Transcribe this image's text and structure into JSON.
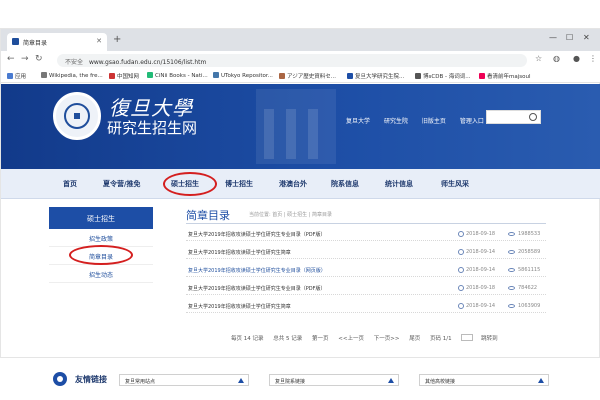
{
  "browser": {
    "tab_title": "简章目录",
    "url": "www.gsao.fudan.edu.cn/15106/list.htm",
    "security_label": "不安全"
  },
  "bookmarks": [
    {
      "label": "应用"
    },
    {
      "label": "Wikipedia, the fre..."
    },
    {
      "label": "中国知网"
    },
    {
      "label": "CiNii Books - Nati..."
    },
    {
      "label": "UTokyo Repositor..."
    },
    {
      "label": "アジア歴史資料セ..."
    },
    {
      "label": "复旦大学研究生院..."
    },
    {
      "label": "博sCDB - 海词词..."
    },
    {
      "label": "看清前年majsoul"
    }
  ],
  "header": {
    "logo_text": "復旦大學",
    "site_name": "研究生招生网",
    "top_links": [
      "复旦大学",
      "研究生院",
      "旧版主页",
      "管理入口"
    ]
  },
  "nav": {
    "items": [
      "首页",
      "夏令营/推免",
      "硕士招生",
      "博士招生",
      "港澳台外",
      "院系信息",
      "统计信息",
      "师生风采"
    ],
    "active": "硕士招生"
  },
  "sidebar": {
    "header": "硕士招生",
    "items": [
      "招生政策",
      "简章目录",
      "招生动态"
    ],
    "active": "简章目录"
  },
  "content": {
    "title": "简章目录",
    "breadcrumb": "当前位置: 首页 | 硕士招生 | 简章目录",
    "rows": [
      {
        "title": "复旦大学2019年招收攻读硕士学位研究生专业目录（PDF版）",
        "date": "2018-09-18",
        "views": "1988533"
      },
      {
        "title": "复旦大学2019年招收攻读硕士学位研究生简章",
        "date": "2018-09-14",
        "views": "2058589"
      },
      {
        "title": "复旦大学2019年招收攻读硕士学位研究生专业目录（网页版）",
        "date": "2018-09-14",
        "views": "5861115"
      },
      {
        "title": "复旦大学2019年招收攻读硕士学位研究生专业目录（PDF版）",
        "date": "2018-09-18",
        "views": "784622"
      },
      {
        "title": "复旦大学2019年招收攻读硕士学位研究生简章",
        "date": "2018-09-14",
        "views": "1063909"
      }
    ],
    "pager": {
      "total": "每页 14 记录",
      "pages": "总共 5 记录",
      "first": "第一页",
      "prev": "<<上一页",
      "next": "下一页>>",
      "last": "尾页",
      "page_of": "页码 1/1",
      "go": "跳转到"
    }
  },
  "friend_links": {
    "title": "友情链接",
    "selects": [
      "复旦常用站点",
      "复旦院系链接",
      "其他高校链接"
    ]
  },
  "colors": {
    "primary": "#1d4ea6",
    "highlight_circle": "#d41f1f"
  }
}
